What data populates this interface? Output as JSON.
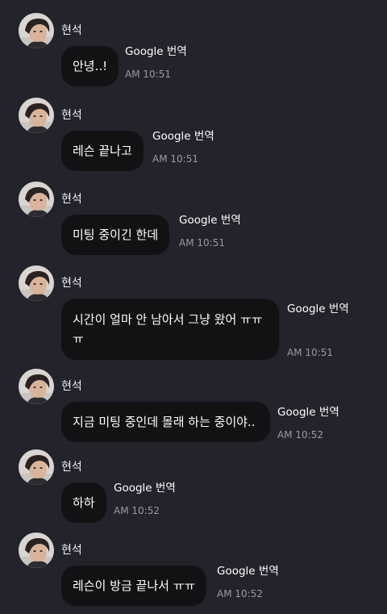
{
  "messages": [
    {
      "sender": "현석",
      "text": "안녕..!",
      "translate": "Google 번역",
      "time": "AM 10:51"
    },
    {
      "sender": "현석",
      "text": "레슨 끝나고",
      "translate": "Google 번역",
      "time": "AM 10:51"
    },
    {
      "sender": "현석",
      "text": "미팅 중이긴 한데",
      "translate": "Google 번역",
      "time": "AM 10:51"
    },
    {
      "sender": "현석",
      "text_line1": "시간이 얼마 안 남아서 그냥 왔어 ㅠㅠ",
      "text_line2": "ㅠ",
      "translate": "Google 번역",
      "time": "AM 10:51"
    },
    {
      "sender": "현석",
      "text": "지금 미팅 중인데 몰래 하는 중이야..",
      "translate": "Google 번역",
      "time": "AM 10:52"
    },
    {
      "sender": "현석",
      "text": "하하",
      "translate": "Google 번역",
      "time": "AM 10:52"
    },
    {
      "sender": "현석",
      "text": "레슨이 방금 끝나서 ㅠㅠ",
      "translate": "Google 번역",
      "time": "AM 10:52"
    }
  ],
  "icons": {
    "avatar": "profile-photo",
    "translate": "none"
  },
  "colors": {
    "background": "#22232b",
    "bubble": "#121214",
    "text": "#ffffff",
    "time": "#9a9aa6"
  }
}
